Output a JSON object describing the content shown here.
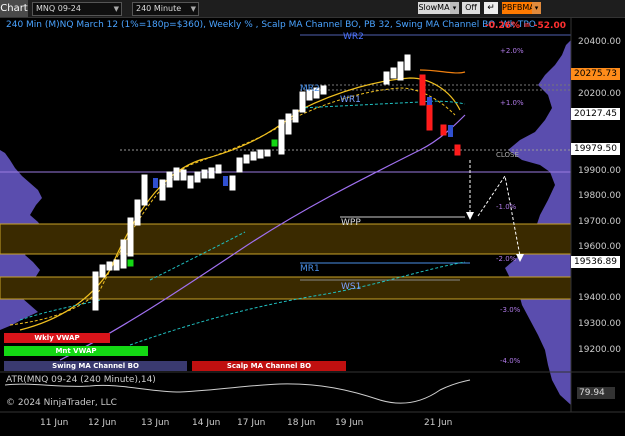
{
  "toolbar": {
    "tab": "Chart",
    "instrument": "MNQ 09-24",
    "interval": "240 Minute",
    "slowma": "SlowMA",
    "off": "Off",
    "pbfbma": "PBFBMA"
  },
  "chart": {
    "title": "240 Min (M)NQ March 12 (1%=180p=$360), Weekly % , Scalp MA Channel BO, PB 32, Swing MA Channel BO, Wk TPO",
    "pnl": "-0.26% = -52.00",
    "levels": {
      "wr2": "WR2",
      "wr1": "WR1",
      "mr2": "MR2",
      "wpp": "WPP",
      "mr1": "MR1",
      "ws1": "WS1",
      "close": "CLOSE"
    },
    "pct_labels": [
      "+2.0%",
      "+1.0%",
      "-1.0%",
      "-2.0%",
      "-3.0%",
      "-4.0%"
    ],
    "price_axis": [
      "20400.00",
      "20200.00",
      "19900.00",
      "19800.00",
      "19700.00",
      "19600.00",
      "19400.00",
      "19300.00",
      "19200.00"
    ],
    "price_tags": [
      {
        "value": "20275.73",
        "color": "#ff8c1a"
      },
      {
        "value": "20127.45",
        "color": "#ffffff"
      },
      {
        "value": "19979.50",
        "color": "#ffffff"
      },
      {
        "value": "19536.89",
        "color": "#ffffff"
      }
    ],
    "legend": {
      "wkly_vwap": "Wkly VWAP",
      "mnt_vwap": "Mnt VWAP",
      "swing": "Swing MA Channel BO",
      "scalp": "Scalp MA Channel BO"
    },
    "legend_colors": {
      "wkly": "#d8141a",
      "mnt": "#14d814",
      "swing": "#3a3a70",
      "scalp": "#c01010"
    }
  },
  "atr": {
    "title": "ATR(MNQ 09-24 (240 Minute),14)",
    "value": "79.94"
  },
  "copyright": "© 2024 NinjaTrader, LLC",
  "x_axis": [
    "11 Jun",
    "12 Jun",
    "13 Jun",
    "14 Jun",
    "17 Jun",
    "18 Jun",
    "19 Jun",
    "21 Jun"
  ],
  "colors": {
    "bg": "#000000",
    "up_candle": "#ffffff",
    "down_candle": "#ff1a1a",
    "band": "#3a2a00",
    "band_edge": "#c8a228",
    "ma_yellow": "#f0c020",
    "ma_purple": "#a070f0",
    "ma_orange": "#f08010",
    "channel_cyan": "#20c0c0"
  }
}
